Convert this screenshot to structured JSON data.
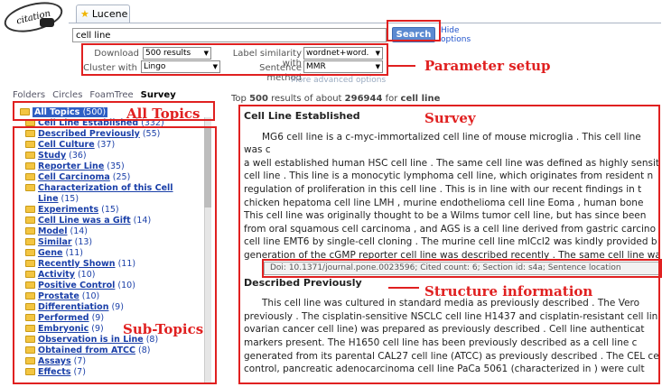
{
  "app": {
    "logo_text": "citation",
    "tab_label": "Lucene"
  },
  "search": {
    "value": "cell line",
    "button": "Search",
    "hide_link_line1": "Hide",
    "hide_link_line2": "options"
  },
  "params": {
    "download_label": "Download",
    "download_value": "500 results",
    "label_similarity_label": "Label similarity with",
    "label_similarity_value": "wordnet+word.",
    "cluster_label": "Cluster with",
    "cluster_value": "Lingo",
    "sentence_label": "Sentence method",
    "sentence_value": "MMR",
    "more_options": "More advanced options"
  },
  "panel_tabs": [
    "Folders",
    "Circles",
    "FoamTree",
    "Survey"
  ],
  "results": {
    "prefix": "Top",
    "shown": "500",
    "middle": "results of about",
    "total": "296944",
    "suffix": "for",
    "query": "cell line"
  },
  "tree": {
    "all_topics": {
      "label": "All Topics",
      "count": "(500)"
    },
    "items": [
      {
        "label": "Cell Line Established",
        "count": "(332)"
      },
      {
        "label": "Described Previously",
        "count": "(55)"
      },
      {
        "label": "Cell Culture",
        "count": "(37)"
      },
      {
        "label": "Study",
        "count": "(36)"
      },
      {
        "label": "Reporter Line",
        "count": "(35)"
      },
      {
        "label": "Cell Carcinoma",
        "count": "(25)"
      },
      {
        "label": "Characterization of this Cell",
        "count": ""
      },
      {
        "label": "Line",
        "count": "(15)"
      },
      {
        "label": "Experiments",
        "count": "(15)"
      },
      {
        "label": "Cell Line was a Gift",
        "count": "(14)"
      },
      {
        "label": "Model",
        "count": "(14)"
      },
      {
        "label": "Similar",
        "count": "(13)"
      },
      {
        "label": "Gene",
        "count": "(11)"
      },
      {
        "label": "Recently Shown",
        "count": "(11)"
      },
      {
        "label": "Activity",
        "count": "(10)"
      },
      {
        "label": "Positive Control",
        "count": "(10)"
      },
      {
        "label": "Prostate",
        "count": "(10)"
      },
      {
        "label": "Differentiation",
        "count": "(9)"
      },
      {
        "label": "Performed",
        "count": "(9)"
      },
      {
        "label": "Embryonic",
        "count": "(9)"
      },
      {
        "label": "Observation is in Line",
        "count": "(8)"
      },
      {
        "label": "Obtained from ATCC",
        "count": "(8)"
      },
      {
        "label": "Assays",
        "count": "(7)"
      },
      {
        "label": "Effects",
        "count": "(7)"
      }
    ]
  },
  "survey": {
    "section1_title": "Cell Line Established",
    "section1_lines": [
      "MG6 cell line is a c-myc-immortalized cell line of mouse microglia . This cell line was c",
      "a well established human HSC cell line . The same cell line was defined as highly sensit",
      "cell line . This line is a monocytic lymphoma cell line, which originates from resident n",
      "regulation of proliferation in this cell line . This is in line with our recent findings in t",
      "chicken hepatoma cell line LMH , murine endothelioma cell line Eoma , human bone",
      "This cell line was originally thought to be a Wilms tumor cell line, but has since been",
      "from oral squamous cell carcinoma , and AGS is a cell line derived from gastric carcino",
      "cell line EMT6 by single-cell cloning . The murine cell line mICcl2 was kindly provided b",
      "generation of the cGMP reporter cell line was described recently . The same cell line wa"
    ],
    "meta": "Doi: 10.1371/journal.pone.0023596;  Cited count: 6;  Section id: s4a;  Sentence location",
    "section2_title": "Described Previously",
    "section2_lines": [
      "This cell line was cultured in standard media as previously described . The Vero",
      "previously . The cisplatin-sensitive NSCLC cell line H1437 and cisplatin-resistant cell lin",
      "ovarian cancer cell line) was prepared as previously described . Cell line authenticat",
      "markers present. The H1650 cell line has been previously described as a cell line c",
      "generated from its parental CAL27 cell line (ATCC) as previously described . The CEL ce",
      "control, pancreatic adenocarcinoma cell line PaCa 5061 (characterized in ) were cult"
    ]
  },
  "annotations": {
    "parameter_setup": "Parameter setup",
    "all_topics": "All Topics",
    "survey": "Survey",
    "structure_information": "Structure information",
    "sub_topics": "Sub-Topics"
  }
}
